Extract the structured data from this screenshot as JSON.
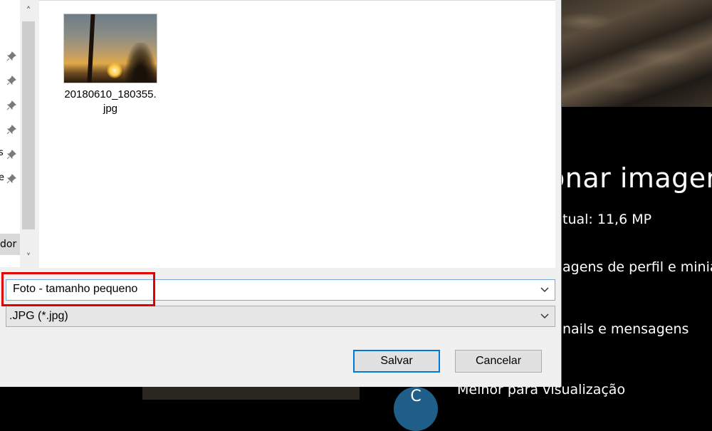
{
  "background_app": {
    "heading": "onar imagen",
    "lines": [
      "tual: 11,6 MP",
      "agens de perfil e minia",
      "nails e mensagens",
      "Melhor para visualização"
    ],
    "circle_letter": "C"
  },
  "dialog": {
    "nav_pane": {
      "fragments": [
        "s",
        "e"
      ],
      "selected_fragment": "dor"
    },
    "files": [
      {
        "name": "20180610_180355.jpg",
        "name_line1": "20180610_180355.",
        "name_line2": "jpg"
      }
    ],
    "file_name_value": "Foto - tamanho pequeno",
    "file_type_value": ".JPG (*.jpg)",
    "save_label": "Salvar",
    "cancel_label": "Cancelar"
  },
  "colors": {
    "highlight_box": "#e00000",
    "primary_button_border": "#0078d7"
  }
}
